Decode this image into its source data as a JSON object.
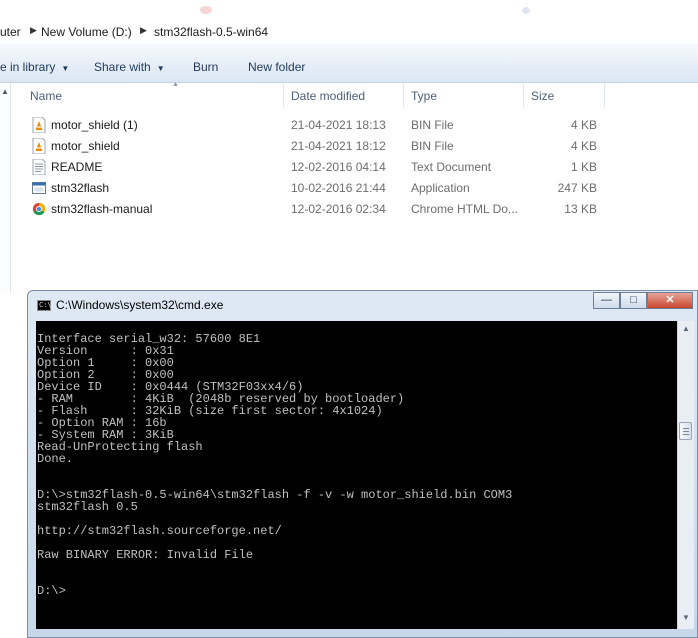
{
  "breadcrumb": [
    "uter",
    "New Volume (D:)",
    "stm32flash-0.5-win64"
  ],
  "toolbar": {
    "include_in_library": "e in library",
    "share_with": "Share with",
    "burn": "Burn",
    "new_folder": "New folder"
  },
  "columns": {
    "name": "Name",
    "date_modified": "Date modified",
    "type": "Type",
    "size": "Size"
  },
  "files": [
    {
      "name": "motor_shield (1)",
      "date": "21-04-2021 18:13",
      "type": "BIN File",
      "size": "4 KB",
      "icon": "vlc-cone-icon"
    },
    {
      "name": "motor_shield",
      "date": "21-04-2021 18:12",
      "type": "BIN File",
      "size": "4 KB",
      "icon": "vlc-cone-icon"
    },
    {
      "name": "README",
      "date": "12-02-2016 04:14",
      "type": "Text Document",
      "size": "1 KB",
      "icon": "text-document-icon"
    },
    {
      "name": "stm32flash",
      "date": "10-02-2016 21:44",
      "type": "Application",
      "size": "247 KB",
      "icon": "application-icon"
    },
    {
      "name": "stm32flash-manual",
      "date": "12-02-2016 02:34",
      "type": "Chrome HTML Do...",
      "size": "13 KB",
      "icon": "chrome-icon"
    }
  ],
  "cmd": {
    "title": "C:\\Windows\\system32\\cmd.exe",
    "icon_text": "C:\\",
    "buttons": {
      "minimize": "—",
      "maximize": "□",
      "close": "✕"
    },
    "output": [
      "Interface serial_w32: 57600 8E1",
      "Version      : 0x31",
      "Option 1     : 0x00",
      "Option 2     : 0x00",
      "Device ID    : 0x0444 (STM32F03xx4/6)",
      "- RAM        : 4KiB  (2048b reserved by bootloader)",
      "- Flash      : 32KiB (size first sector: 4x1024)",
      "- Option RAM : 16b",
      "- System RAM : 3KiB",
      "Read-UnProtecting flash",
      "Done.",
      "",
      "",
      "D:\\>stm32flash-0.5-win64\\stm32flash -f -v -w motor_shield.bin COM3",
      "stm32flash 0.5",
      "",
      "http://stm32flash.sourceforge.net/",
      "",
      "Raw BINARY ERROR: Invalid File",
      "",
      "",
      "D:\\>"
    ]
  },
  "colors": {
    "console_bg": "#000000",
    "console_text": "#c0c0c0",
    "close_button": "#c9462c"
  }
}
